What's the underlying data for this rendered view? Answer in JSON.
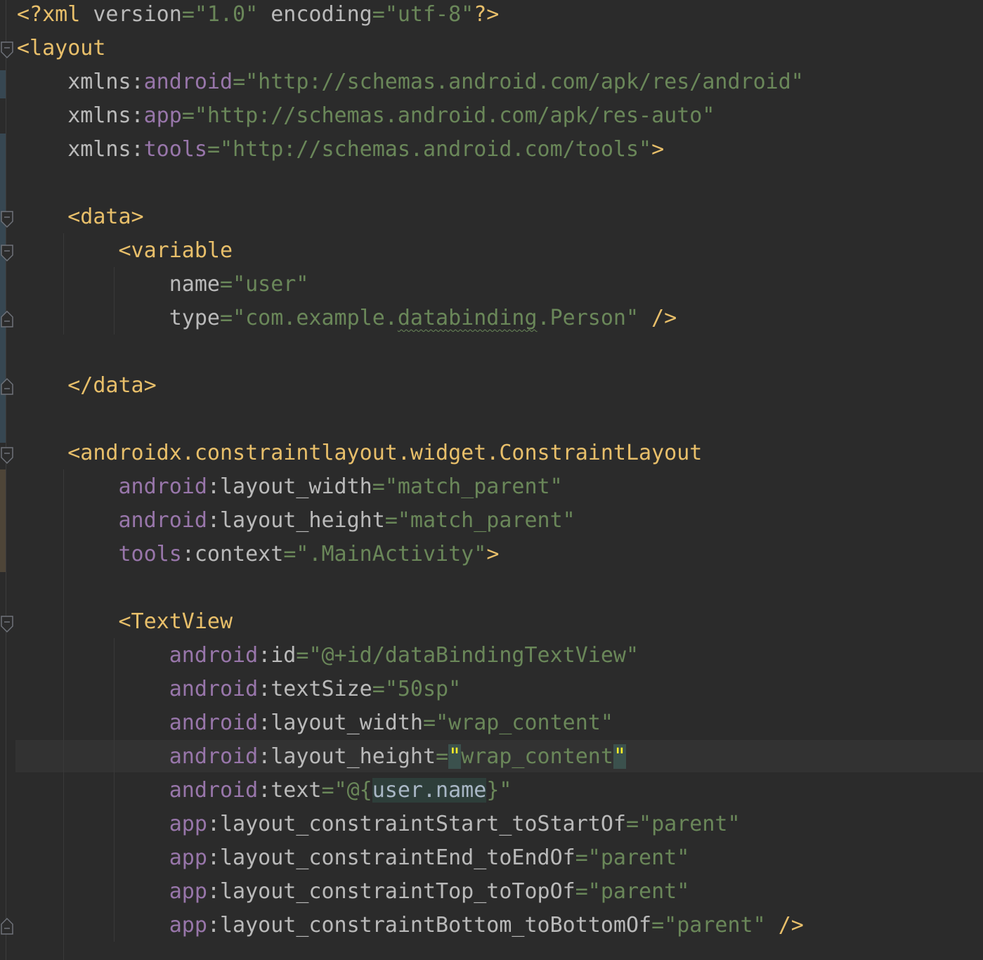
{
  "colors": {
    "background": "#2b2b2b",
    "tag": "#e8bf6a",
    "attribute": "#bababa",
    "namespace": "#9876aa",
    "string": "#6a8759",
    "caret_line": "#323232",
    "matched_quote": "#ffef28"
  },
  "icons": {
    "fold_open": "fold-open-icon",
    "fold_close": "fold-close-icon"
  },
  "editor": {
    "lines": {
      "l1": {
        "a": "<?xml ",
        "b": "version",
        "c": "=",
        "d": "\"1.0\"",
        "e": " ",
        "f": "encoding",
        "g": "=",
        "h": "\"utf-8\"",
        "i": "?>"
      },
      "l2": {
        "a": "<layout"
      },
      "l3": {
        "a": "    ",
        "b": "xmlns:",
        "c": "android",
        "d": "=",
        "e": "\"http://schemas.android.com/apk/res/android\""
      },
      "l4": {
        "a": "    ",
        "b": "xmlns:",
        "c": "app",
        "d": "=",
        "e": "\"http://schemas.android.com/apk/res-auto\""
      },
      "l5": {
        "a": "    ",
        "b": "xmlns:",
        "c": "tools",
        "d": "=",
        "e": "\"http://schemas.android.com/tools\"",
        "f": ">"
      },
      "l7": {
        "a": "    ",
        "b": "<data>"
      },
      "l8": {
        "a": "        ",
        "b": "<variable"
      },
      "l9": {
        "a": "            ",
        "b": "name",
        "c": "=",
        "d": "\"user\""
      },
      "l10": {
        "a": "            ",
        "b": "type",
        "c": "=",
        "d": "\"com.example.",
        "e": "databinding",
        "f": ".Person\"",
        "g": " ",
        "h": "/>"
      },
      "l12": {
        "a": "    ",
        "b": "</data>"
      },
      "l14": {
        "a": "    ",
        "b": "<androidx.constraintlayout.widget.ConstraintLayout"
      },
      "l15": {
        "a": "        ",
        "b": "android",
        "c": ":layout_width",
        "d": "=",
        "e": "\"match_parent\""
      },
      "l16": {
        "a": "        ",
        "b": "android",
        "c": ":layout_height",
        "d": "=",
        "e": "\"match_parent\""
      },
      "l17": {
        "a": "        ",
        "b": "tools",
        "c": ":context",
        "d": "=",
        "e": "\".MainActivity\"",
        "f": ">"
      },
      "l19": {
        "a": "        ",
        "b": "<TextView"
      },
      "l20": {
        "a": "            ",
        "b": "android",
        "c": ":id",
        "d": "=",
        "e": "\"@+id/dataBindingTextView\""
      },
      "l21": {
        "a": "            ",
        "b": "android",
        "c": ":textSize",
        "d": "=",
        "e": "\"50sp\""
      },
      "l22": {
        "a": "            ",
        "b": "android",
        "c": ":layout_width",
        "d": "=",
        "e": "\"wrap_content\""
      },
      "l23": {
        "a": "            ",
        "b": "android",
        "c": ":layout_height",
        "d": "=",
        "e": "\"",
        "f": "wrap_content",
        "g": "\""
      },
      "l24": {
        "a": "            ",
        "b": "android",
        "c": ":text",
        "d": "=",
        "e": "\"@{",
        "f": "user.name",
        "g": "}\""
      },
      "l25": {
        "a": "            ",
        "b": "app",
        "c": ":layout_constraintStart_toStartOf",
        "d": "=",
        "e": "\"parent\""
      },
      "l26": {
        "a": "            ",
        "b": "app",
        "c": ":layout_constraintEnd_toEndOf",
        "d": "=",
        "e": "\"parent\""
      },
      "l27": {
        "a": "            ",
        "b": "app",
        "c": ":layout_constraintTop_toTopOf",
        "d": "=",
        "e": "\"parent\""
      },
      "l28": {
        "a": "            ",
        "b": "app",
        "c": ":layout_constraintBottom_toBottomOf",
        "d": "=",
        "e": "\"parent\"",
        "f": " ",
        "g": "/>"
      }
    }
  }
}
